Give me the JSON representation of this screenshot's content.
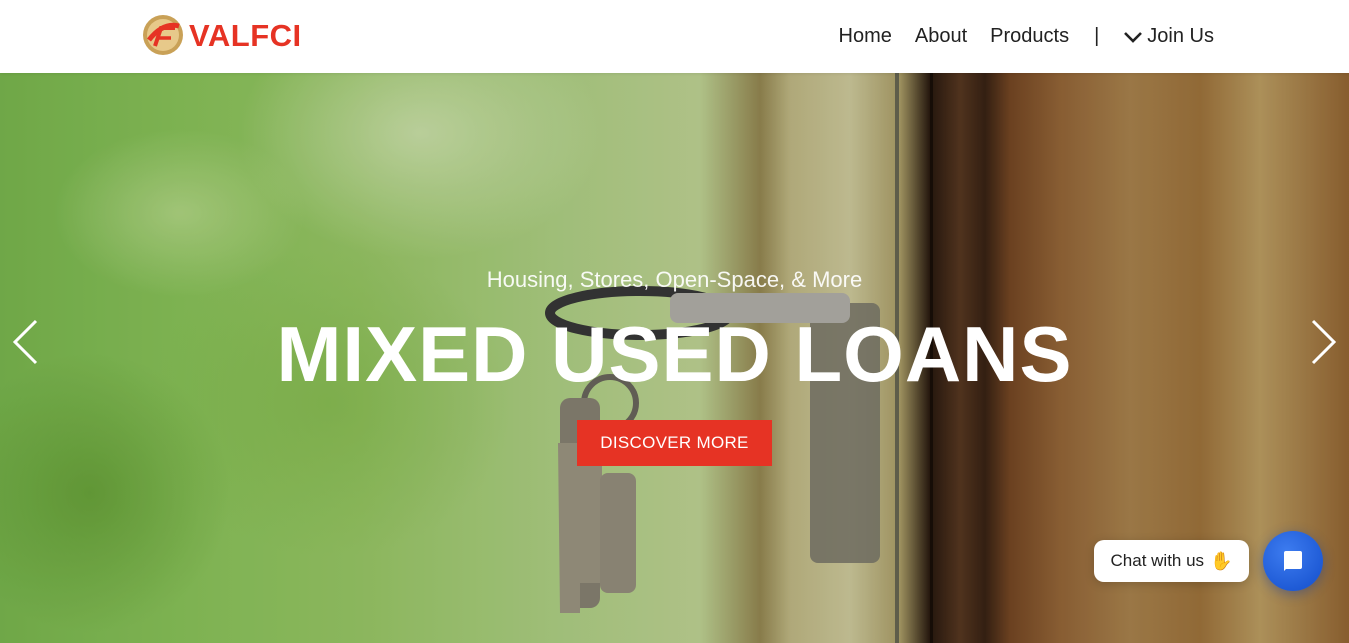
{
  "header": {
    "logo_text": "VALFCI",
    "logo_mark_text": "VALFCI",
    "nav": {
      "home": "Home",
      "about": "About",
      "products": "Products",
      "separator": "|",
      "join": "Join Us"
    }
  },
  "hero": {
    "subtitle": "Housing, Stores, Open-Space, & More",
    "title": "MIXED USED LOANS",
    "cta_label": "DISCOVER MORE"
  },
  "chat": {
    "label": "Chat with us",
    "wave_icon": "waving-hand-icon"
  },
  "colors": {
    "brand_red": "#e63324",
    "chat_blue": "#1f5bd6"
  }
}
